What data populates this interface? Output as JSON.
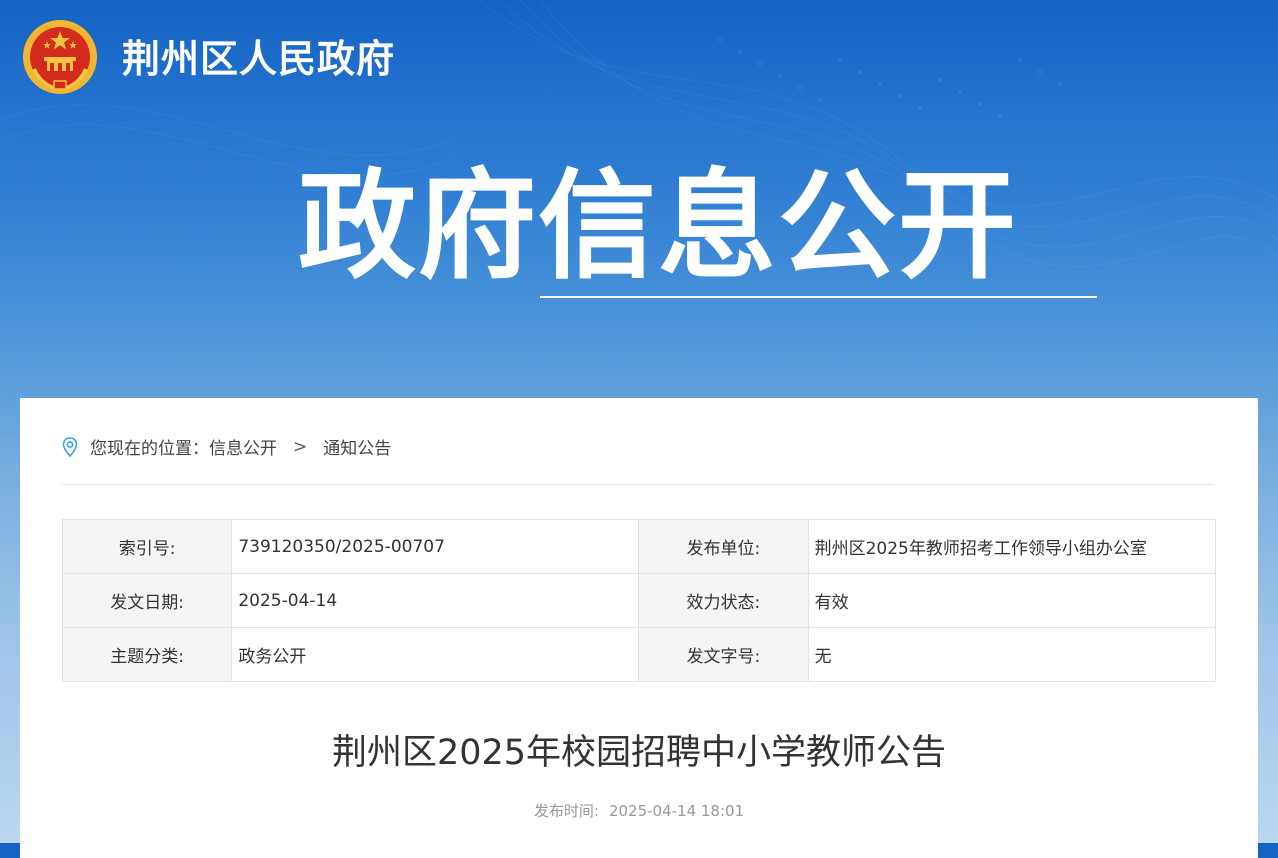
{
  "site": {
    "name": "荆州区人民政府",
    "emblem_icon": "national-emblem-icon"
  },
  "banner": {
    "title": "政府信息公开"
  },
  "breadcrumb": {
    "icon": "location-pin-icon",
    "prefix": "您现在的位置：",
    "items": [
      "信息公开",
      "通知公告"
    ],
    "separator": ">"
  },
  "meta": {
    "rows": [
      {
        "label_left": "索引号:",
        "value_left": "739120350/2025-00707",
        "label_right": "发布单位:",
        "value_right": "荆州区2025年教师招考工作领导小组办公室"
      },
      {
        "label_left": "发文日期:",
        "value_left": "2025-04-14",
        "label_right": "效力状态:",
        "value_right": "有效"
      },
      {
        "label_left": "主题分类:",
        "value_left": "政务公开",
        "label_right": "发文字号:",
        "value_right": "无"
      }
    ]
  },
  "article": {
    "title": "荆州区2025年校园招聘中小学教师公告",
    "publish_label": "发布时间:",
    "publish_time": "2025-04-14 18:01"
  },
  "colors": {
    "header_blue": "#1463c4",
    "emblem_red": "#d52b1e",
    "emblem_gold": "#f5c542",
    "pin_blue": "#3aa0d8"
  }
}
